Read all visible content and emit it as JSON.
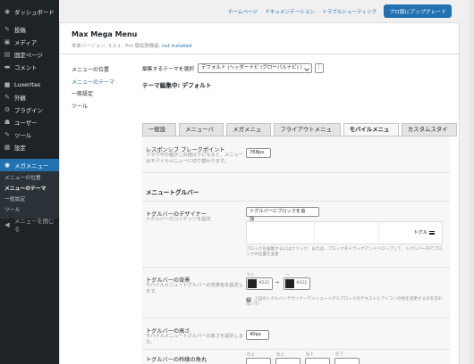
{
  "sidebar": {
    "items": [
      {
        "icon": "dashboard-icon",
        "glyph": "◉",
        "label": "ダッシュボード"
      },
      {
        "icon": "pin-icon",
        "glyph": "✎",
        "label": "投稿"
      },
      {
        "icon": "media-icon",
        "glyph": "▣",
        "label": "メディア"
      },
      {
        "icon": "page-icon",
        "glyph": "▤",
        "label": "固定ページ"
      },
      {
        "icon": "comment-icon",
        "glyph": "▬",
        "label": "コメント"
      },
      {
        "icon": "luxeritas-icon",
        "glyph": "■",
        "label": "Luxeritas"
      },
      {
        "icon": "appearance-icon",
        "glyph": "✎",
        "label": "外観"
      },
      {
        "icon": "plugin-icon",
        "glyph": "⚙",
        "label": "プラグイン"
      },
      {
        "icon": "user-icon",
        "glyph": "☗",
        "label": "ユーザー"
      },
      {
        "icon": "tool-icon",
        "glyph": "✎",
        "label": "ツール"
      },
      {
        "icon": "settings-icon",
        "glyph": "▦",
        "label": "設定"
      }
    ],
    "active": {
      "icon": "megamenu-icon",
      "glyph": "◉",
      "label": "メガメニュー"
    },
    "submenu": [
      "メニューの位置",
      "メニューのテーマ",
      "一般設定",
      "ツール"
    ],
    "collapse": {
      "icon": "collapse-icon",
      "glyph": "◀",
      "label": "メニューを閉じる"
    }
  },
  "topbar": {
    "links": [
      "ホームページ",
      "ドキュメンテーション",
      "トラブルシューティング"
    ],
    "upgrade": "プロ版にアップグレード"
  },
  "header": {
    "title": "Max Mega Menu",
    "version": "本体バージョン: 3.3.1 - Pro 版拡張機能:",
    "not_installed": "not installed"
  },
  "left_nav": [
    "メニューの位置",
    "メニューのテーマ",
    "一般設定",
    "ツール"
  ],
  "theme_select": {
    "label": "編集するテーマを選択",
    "value": "デフォルト (ヘッダーナビ (グローバルナビ) )",
    "dots": "⋮"
  },
  "editing": "テーマ編集中: デフォルト",
  "tabs": [
    "一般設定",
    "メニューバー",
    "メガメニュー",
    "フライアウトメニュー",
    "モバイルメニュー",
    "カスタムスタイル"
  ],
  "rows": {
    "breakpoint": {
      "label": "レスポンシブ ブレークポイント",
      "desc": "ブラウザの幅がこの値以下になると、メニューはモバイルメニューに切り替わります。",
      "value": "768px"
    },
    "toggle_section": "メニュートグルバー",
    "designer": {
      "label": "トグルバーのデザイナー",
      "desc": "トグルバーのコンテンツを設定",
      "select": "トグルバーにブロックを追加",
      "toggle_text": "トグル",
      "note": "ブロックを編集するにはクリック、または、ブロックをドラッグアンドドロップして、トグルバー内でブロックの位置を変更"
    },
    "background": {
      "label": "トグルバーの背景",
      "desc": "モバイルメニュートグルバーの背景色を設定します。",
      "from_label": "から",
      "to_label": "へ",
      "from_hex": "#222",
      "to_hex": "#222",
      "arrow": "→",
      "note": "上記のトグルバーデザイナーでメニュートグルブロックのテキストとアイコンの色を変更するのを忘れないで！"
    },
    "height": {
      "label": "トグルバーの高さ",
      "desc": "モバイルメニュートグルバーの高さを設定します。",
      "value": "40px"
    },
    "radius": {
      "label": "トグルバーの枠線の角丸",
      "corners": [
        "左上",
        "右上",
        "右下",
        "左下"
      ]
    }
  },
  "colors": {
    "accent": "#2271b1",
    "sidebar": "#1d2327",
    "swatch": "#222222"
  }
}
